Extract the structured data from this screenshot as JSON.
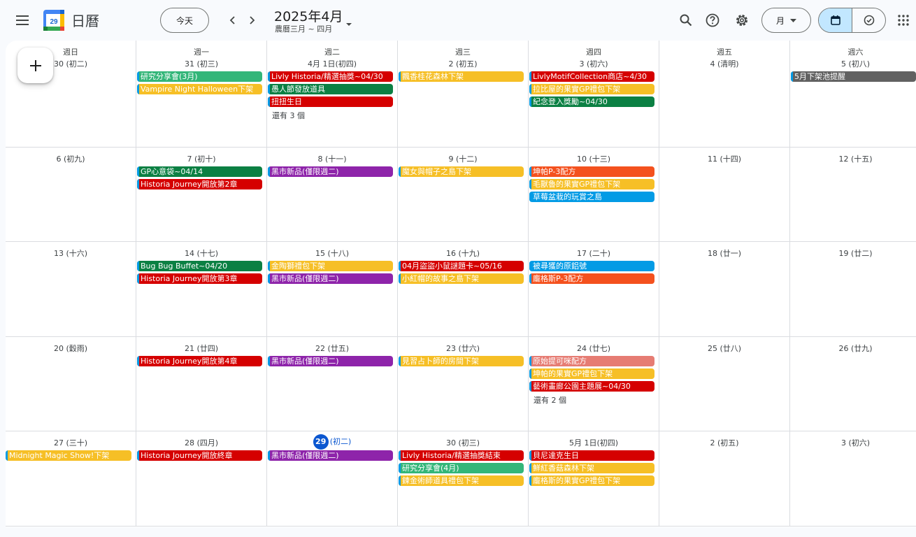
{
  "header": {
    "app_title": "日曆",
    "logo_day": "29",
    "today_label": "今天",
    "period_title": "2025年4月",
    "period_sub": "農曆三月 ~ 四月",
    "view_label": "月"
  },
  "colors": {
    "green": "#0b8043",
    "teal": "#33b679",
    "yellow": "#f6bf26",
    "red": "#d50000",
    "purple": "#8e24aa",
    "orange": "#f4511e",
    "blue": "#039be5",
    "flamingo": "#e67c73",
    "graphite": "#616161"
  },
  "weekdays": [
    "週日",
    "週一",
    "週二",
    "週三",
    "週四",
    "週五",
    "週六"
  ],
  "weeks": [
    [
      {
        "label": "30 (初二)",
        "events": []
      },
      {
        "label": "31 (初三)",
        "events": [
          {
            "title": "研究分享會(3月)",
            "color": "teal"
          },
          {
            "title": "Vampire Night Halloween下架",
            "color": "yellow"
          }
        ]
      },
      {
        "label": "4月 1日(初四)",
        "events": [
          {
            "title": "Livly Historia/精選抽獎~04/30",
            "color": "red"
          },
          {
            "title": "愚人節發放道具",
            "color": "green"
          },
          {
            "title": "扭扭生日",
            "color": "red"
          }
        ],
        "more": "還有 3 個"
      },
      {
        "label": "2 (初五)",
        "events": [
          {
            "title": "飄香桂花森林下架",
            "color": "yellow"
          }
        ]
      },
      {
        "label": "3 (初六)",
        "events": [
          {
            "title": "LivlyMotifCollection商店~4/30",
            "color": "red"
          },
          {
            "title": "拉比屋的果實GP禮包下架",
            "color": "yellow"
          },
          {
            "title": "紀念登入獎勵~04/30",
            "color": "green"
          }
        ]
      },
      {
        "label": "4 (清明)",
        "events": []
      },
      {
        "label": "5 (初八)",
        "events": [
          {
            "title": "5月下架池提醒",
            "color": "graphite"
          }
        ]
      }
    ],
    [
      {
        "label": "6 (初九)",
        "events": []
      },
      {
        "label": "7 (初十)",
        "events": [
          {
            "title": "GP心意袋~04/14",
            "color": "green"
          },
          {
            "title": "Historia Journey開放第2章",
            "color": "red"
          }
        ]
      },
      {
        "label": "8 (十一)",
        "events": [
          {
            "title": "黑市新品(僅限週二)",
            "color": "purple"
          }
        ]
      },
      {
        "label": "9 (十二)",
        "events": [
          {
            "title": "魔女與帽子之島下架",
            "color": "yellow"
          }
        ]
      },
      {
        "label": "10 (十三)",
        "events": [
          {
            "title": "坤帕P-3配方",
            "color": "orange"
          },
          {
            "title": "毛獸魯的果實GP禮包下架",
            "color": "yellow"
          },
          {
            "title": "草莓盆栽的玩賞之島",
            "color": "blue"
          }
        ]
      },
      {
        "label": "11 (十四)",
        "events": []
      },
      {
        "label": "12 (十五)",
        "events": []
      }
    ],
    [
      {
        "label": "13 (十六)",
        "events": []
      },
      {
        "label": "14 (十七)",
        "events": [
          {
            "title": "Bug Bug Buffet~04/20",
            "color": "green"
          },
          {
            "title": "Historia Journey開放第3章",
            "color": "red"
          }
        ]
      },
      {
        "label": "15 (十八)",
        "events": [
          {
            "title": "金陶獅禮包下架",
            "color": "yellow"
          },
          {
            "title": "黑市新品(僅限週二)",
            "color": "purple"
          }
        ]
      },
      {
        "label": "16 (十九)",
        "events": [
          {
            "title": "04月盜盜小鼠謎題卡~05/16",
            "color": "red"
          },
          {
            "title": "小紅帽的故事之島下架",
            "color": "yellow"
          }
        ]
      },
      {
        "label": "17 (二十)",
        "events": [
          {
            "title": "被尋獲的原鋁號",
            "color": "blue"
          },
          {
            "title": "龐格斯P-3配方",
            "color": "orange"
          }
        ]
      },
      {
        "label": "18 (廿一)",
        "events": []
      },
      {
        "label": "19 (廿二)",
        "events": []
      }
    ],
    [
      {
        "label": "20 (穀雨)",
        "events": []
      },
      {
        "label": "21 (廿四)",
        "events": [
          {
            "title": "Historia Journey開放第4章",
            "color": "red"
          }
        ]
      },
      {
        "label": "22 (廿五)",
        "events": [
          {
            "title": "黑市新品(僅限週二)",
            "color": "purple"
          }
        ]
      },
      {
        "label": "23 (廿六)",
        "events": [
          {
            "title": "見習占卜師的房間下架",
            "color": "yellow"
          }
        ]
      },
      {
        "label": "24 (廿七)",
        "events": [
          {
            "title": "原始提可咪配方",
            "color": "flamingo"
          },
          {
            "title": "坤帕的果實GP禮包下架",
            "color": "yellow"
          },
          {
            "title": "藝術畫廊公園主題展~04/30",
            "color": "red"
          }
        ],
        "more": "還有 2 個"
      },
      {
        "label": "25 (廿八)",
        "events": []
      },
      {
        "label": "26 (廿九)",
        "events": []
      }
    ],
    [
      {
        "label": "27 (三十)",
        "events": [
          {
            "title": "Midnight Magic Show!下架",
            "color": "yellow"
          }
        ]
      },
      {
        "label": "28 (四月)",
        "events": [
          {
            "title": "Historia Journey開放終章",
            "color": "red"
          }
        ]
      },
      {
        "label": "29",
        "lunar": "(初二)",
        "today": true,
        "events": [
          {
            "title": "黑市新品(僅限週二)",
            "color": "purple"
          }
        ]
      },
      {
        "label": "30 (初三)",
        "events": [
          {
            "title": "Livly Historia/精選抽獎結束",
            "color": "red"
          },
          {
            "title": "研究分享會(4月)",
            "color": "teal"
          },
          {
            "title": "鍊金術師道具禮包下架",
            "color": "yellow"
          }
        ]
      },
      {
        "label": "5月 1日(初四)",
        "events": [
          {
            "title": "貝尼達克生日",
            "color": "red"
          },
          {
            "title": "鮮紅香菇森林下架",
            "color": "yellow"
          },
          {
            "title": "龐格斯的果實GP禮包下架",
            "color": "yellow"
          }
        ]
      },
      {
        "label": "2 (初五)",
        "events": []
      },
      {
        "label": "3 (初六)",
        "events": []
      }
    ]
  ]
}
